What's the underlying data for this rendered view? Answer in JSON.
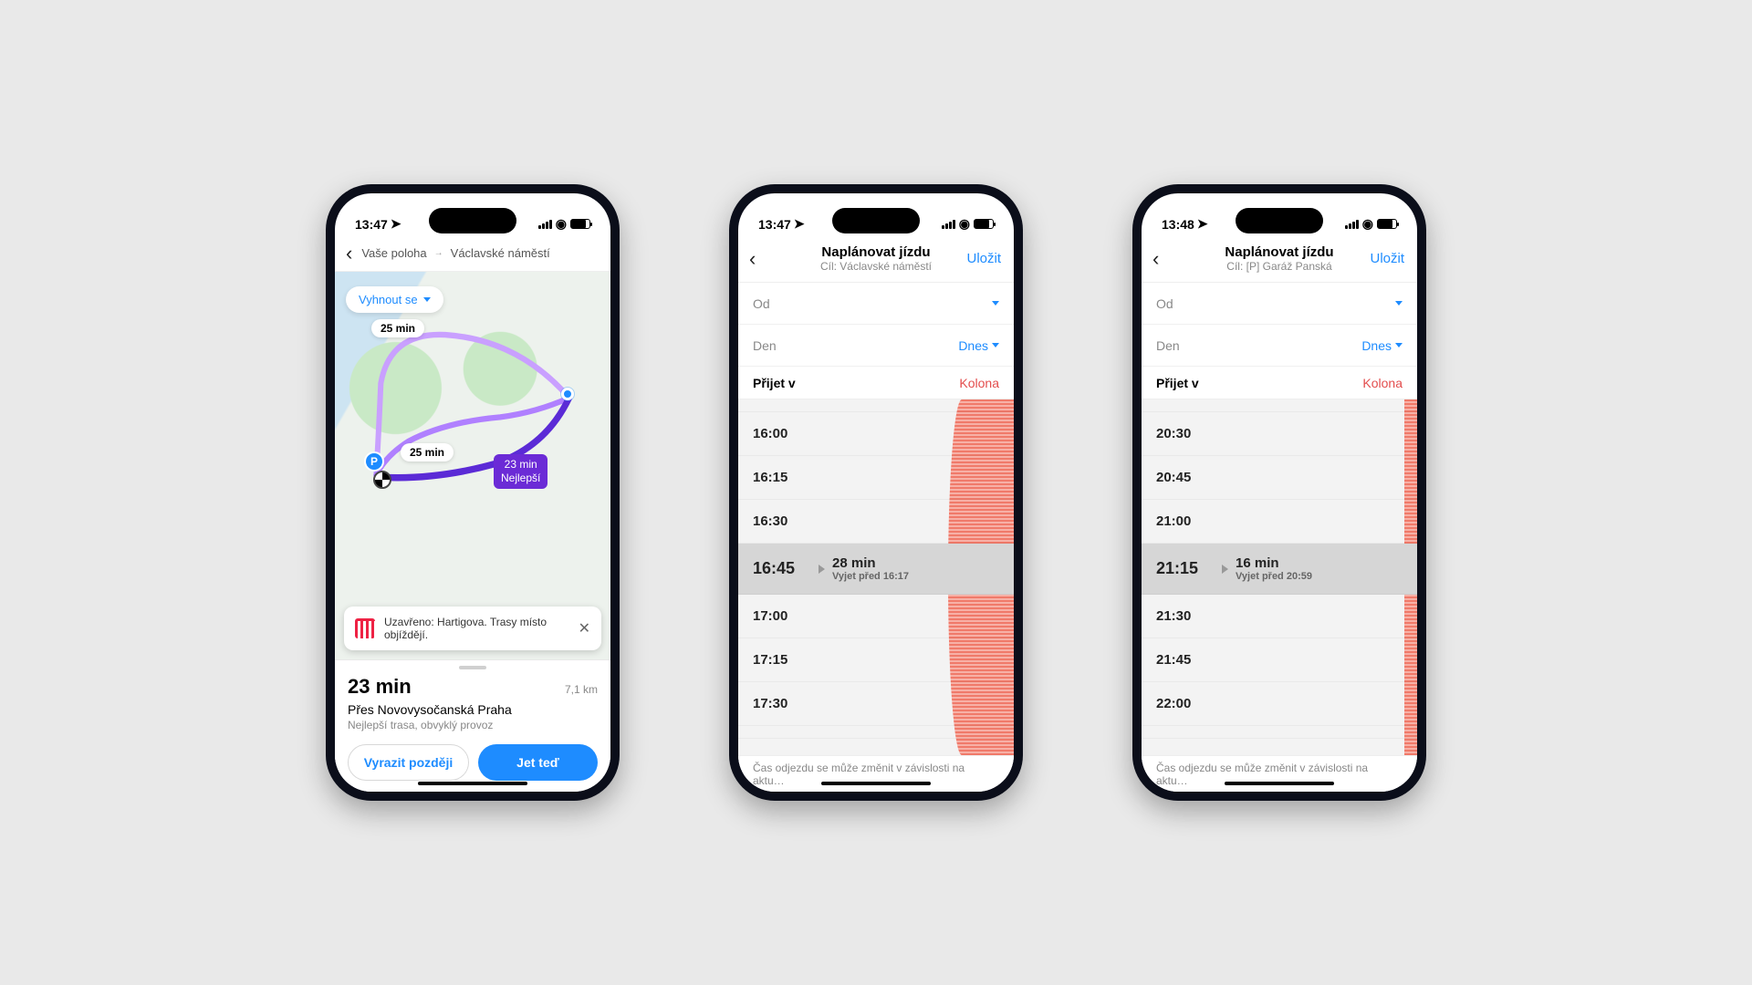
{
  "phone1": {
    "time": "13:47",
    "breadcrumb_from": "Vaše poloha",
    "breadcrumb_to": "Václavské náměstí",
    "avoid_label": "Vyhnout se",
    "route_a_time": "25 min",
    "route_b_time": "25 min",
    "best_time": "23 min",
    "best_label": "Nejlepší",
    "alert_text": "Uzavřeno: Hartigova. Trasy místo objíždějí.",
    "summary_time": "23 min",
    "summary_dist": "7,1 km",
    "summary_via": "Přes Novovysočanská Praha",
    "summary_desc": "Nejlepší trasa, obvyklý provoz",
    "btn_later": "Vyrazit později",
    "btn_go": "Jet teď"
  },
  "phone2": {
    "time": "13:47",
    "title": "Naplánovat jízdu",
    "subtitle": "Cíl: Václavské náměstí",
    "save": "Uložit",
    "row_from": "Od",
    "row_day": "Den",
    "row_day_val": "Dnes",
    "hdr_left": "Přijet v",
    "hdr_right": "Kolona",
    "rows": [
      "16:00",
      "16:15",
      "16:30",
      "16:45",
      "17:00",
      "17:15",
      "17:30"
    ],
    "sel": {
      "time": "16:45",
      "dur": "28 min",
      "leave": "Vyjet před 16:17"
    },
    "footer": "Čas odjezdu se může změnit v závislosti na aktu…"
  },
  "phone3": {
    "time": "13:48",
    "title": "Naplánovat jízdu",
    "subtitle": "Cíl: [P] Garáž Panská",
    "save": "Uložit",
    "row_from": "Od",
    "row_day": "Den",
    "row_day_val": "Dnes",
    "hdr_left": "Přijet v",
    "hdr_right": "Kolona",
    "rows": [
      "20:30",
      "20:45",
      "21:00",
      "21:15",
      "21:30",
      "21:45",
      "22:00"
    ],
    "sel": {
      "time": "21:15",
      "dur": "16 min",
      "leave": "Vyjet před 20:59"
    },
    "footer": "Čas odjezdu se může změnit v závislosti na aktu…"
  }
}
